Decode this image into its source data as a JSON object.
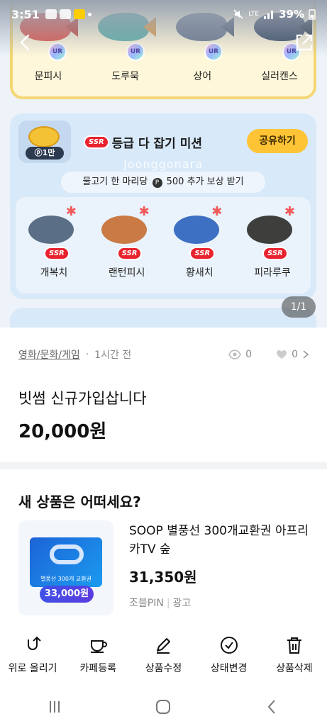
{
  "status_bar": {
    "time": "3:51",
    "battery": "39%",
    "network": "LTE"
  },
  "hero": {
    "top_fish": [
      {
        "name": "문피시",
        "badge": "UR",
        "color": "#e2574c",
        "tail": "#c9443a"
      },
      {
        "name": "도루묵",
        "badge": "UR",
        "color": "#5fb0a8",
        "tail": "#e6a04a"
      },
      {
        "name": "상어",
        "badge": "UR",
        "color": "#6b7a8f",
        "tail": "#56657a"
      },
      {
        "name": "실러캔스",
        "badge": "UR",
        "color": "#3c4d66",
        "tail": "#2d3a4f"
      }
    ],
    "mission": {
      "coin_label": "ⓟ1만",
      "ssr_badge": "SSR",
      "title": "등급 다 잡기 미션",
      "share_label": "공유하기",
      "watermark": "Joonggonara",
      "reward_prefix": "물고기 한 마리당",
      "reward_points_icon": "P",
      "reward_suffix": "500 추가 보상 받기",
      "fish": [
        {
          "name": "개복치",
          "badge": "SSR",
          "color": "#5a6f86"
        },
        {
          "name": "랜턴피시",
          "badge": "SSR",
          "color": "#c97a45"
        },
        {
          "name": "황새치",
          "badge": "SSR",
          "color": "#3d6fc2"
        },
        {
          "name": "피라루쿠",
          "badge": "SSR",
          "color": "#3e3f3c"
        }
      ]
    },
    "page_indicator": "1/1"
  },
  "post": {
    "category": "영화/문화/게임",
    "time_ago": "1시간 전",
    "views": "0",
    "likes": "0",
    "title": "빗썸 신규가입삽니다",
    "price": "20,000원"
  },
  "recommend": {
    "section_title": "새 상품은 어떠세요?",
    "item": {
      "title": "SOOP 별풍선 300개교환권 아프리카TV 숲",
      "price": "31,350원",
      "seller": "조블PIN",
      "tag": "광고",
      "thumb_caption": "별풍선 300개 교환권",
      "thumb_price": "33,000원"
    }
  },
  "toolbar": {
    "items": [
      {
        "label": "위로 올리기",
        "icon": "bump-up-icon"
      },
      {
        "label": "카페등록",
        "icon": "cafe-cup-icon"
      },
      {
        "label": "상품수정",
        "icon": "edit-pencil-icon"
      },
      {
        "label": "상태변경",
        "icon": "check-circle-icon"
      },
      {
        "label": "상품삭제",
        "icon": "trash-icon"
      }
    ]
  },
  "android_nav": {
    "icons": [
      "recent-apps-icon",
      "home-icon",
      "back-icon"
    ]
  }
}
